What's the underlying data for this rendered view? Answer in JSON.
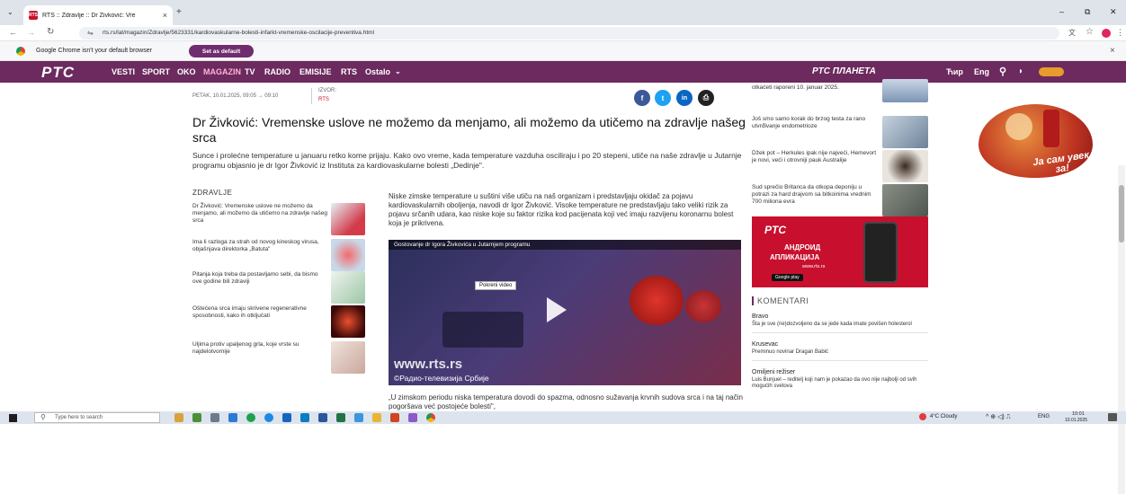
{
  "browser": {
    "tab_title": "RTS :: Zdravlje :: Dr Živković: Vre",
    "tab_close": "×",
    "new_tab": "+",
    "url": "rts.rs/lat/magazin/Zdravlje/5623331/kardiovaskularne-bolesti-infarkt-vremenske-oscilacije-preventiva.html",
    "win_min": "–",
    "win_max": "⧉",
    "win_close": "✕",
    "info_text": "Google Chrome isn't your default browser",
    "set_default": "Set as default",
    "info_close": "×"
  },
  "nav": {
    "logo": "PTC",
    "items": [
      "VESTI",
      "SPORT",
      "OKO",
      "MAGAZIN",
      "TV",
      "RADIO",
      "EMISIJE",
      "RTS",
      "Ostalo"
    ],
    "planeta": "PTC ПЛАНЕТА",
    "script": "Ћир",
    "lang": "Eng"
  },
  "article": {
    "date": "PETAK, 10.01.2025, 09:05 → 09:10",
    "source_label": "IZVOR:",
    "source": "RTS",
    "title": "Dr Živković: Vremenske uslove ne možemo da menjamo, ali možemo da utičemo na zdravlje našeg srca",
    "lead": "Sunce i prolećne temperature u januaru retko kome prijaju. Kako ovo vreme, kada temperature vazduha osciliraju i po 20 stepeni, utiče na naše zdravlje u Jutarnje programu objasnio je dr Igor Živković iz Instituta za kardiovaskularne bolesti „Dedinje\".",
    "body": "Niske zimske temperature u suštini više utiču na naš organizam i predstavljaju okidač za pojavu kardiovaskularnih oboljenja, navodi dr Igor Živković. Visoke temperature ne predstavljaju tako veliki rizik za pojavu srčanih udara, kao niske koje su faktor rizika kod pacijenata koji već imaju razvijenu koronarnu bolest koja je prikrivena.",
    "video_title": "Gostovanje dr Igora Živkovića u Jutarnjem programu",
    "video_tooltip": "Pokreni video",
    "watermark": "www.rts.rs",
    "watermark2": "©Радио-телевизија Србије",
    "quote": "„U zimskom periodu niska temperatura dovodi do spazma, odnosno sužavanja krvnih sudova srca i na taj način pogoršava već postojeće bolesti\","
  },
  "share": {
    "facebook": "f",
    "twitter": "t",
    "linkedin": "in",
    "print": "⎙"
  },
  "sidebar": {
    "title": "ZDRAVLJE",
    "items": [
      "Dr Živković: Vremenske uslove ne možemo da menjamo, ali možemo da utičemo na zdravlje našeg srca",
      "Ima li razloga za strah od novog kineskog virusa, objašnjava direktorka „Batuta\"",
      "Pitanja koja treba da postavljamo sebi, da bismo ove godine bili zdraviji",
      "Oštećena srca imaju skrivene regenerativne sposobnosti, kako ih otključati",
      "Uljima protiv upaljenog grla, koje vrste su najdelotvornije"
    ]
  },
  "right": {
    "news": [
      "otkaćeti raporeni 10. januar 2025.",
      "Još smo samo korak do brzog testa za rano utvrđivanje endometrioze",
      "Džek pot – Herkules ipak nije najveći, Hemevort je novi, veći i otrovniji pauk Australije",
      "Sud sprečio Britanca da otkopa deponiju u potrazi za hard drajvom sa bitkoinima vrednim 700 miliona evra"
    ],
    "app_logo": "PTC",
    "app_line1": "АНДРОИД",
    "app_line2": "АПЛИКАЦИЈА",
    "app_url": "www.rts.rs",
    "app_store": "Google play"
  },
  "comments": {
    "header": "KOMENTARI",
    "items": [
      {
        "user": "Bravo",
        "text": "Šta je sve (ne)dozvoljeno da se jede kada imate povišen holesterol"
      },
      {
        "user": "Krusevac",
        "text": "Preminuo novinar Dragan Babić"
      },
      {
        "user": "Omiljeni režiser",
        "text": "Luis Bunjuel – reditelj koji nam je pokazao da ovo nije najbolji od svih mogućih svetova"
      }
    ]
  },
  "ad": {
    "text": "Ja сам увек за!"
  },
  "taskbar": {
    "search": "Type here to search",
    "weather": "4°C Cloudy",
    "lang": "ENG",
    "time": "10:01",
    "date": "10.01.2025"
  },
  "colors": {
    "brand": "#6c2a5e",
    "red": "#c8102e",
    "facebook": "#3b5998",
    "twitter": "#1da1f2",
    "linkedin": "#0a66c2"
  }
}
